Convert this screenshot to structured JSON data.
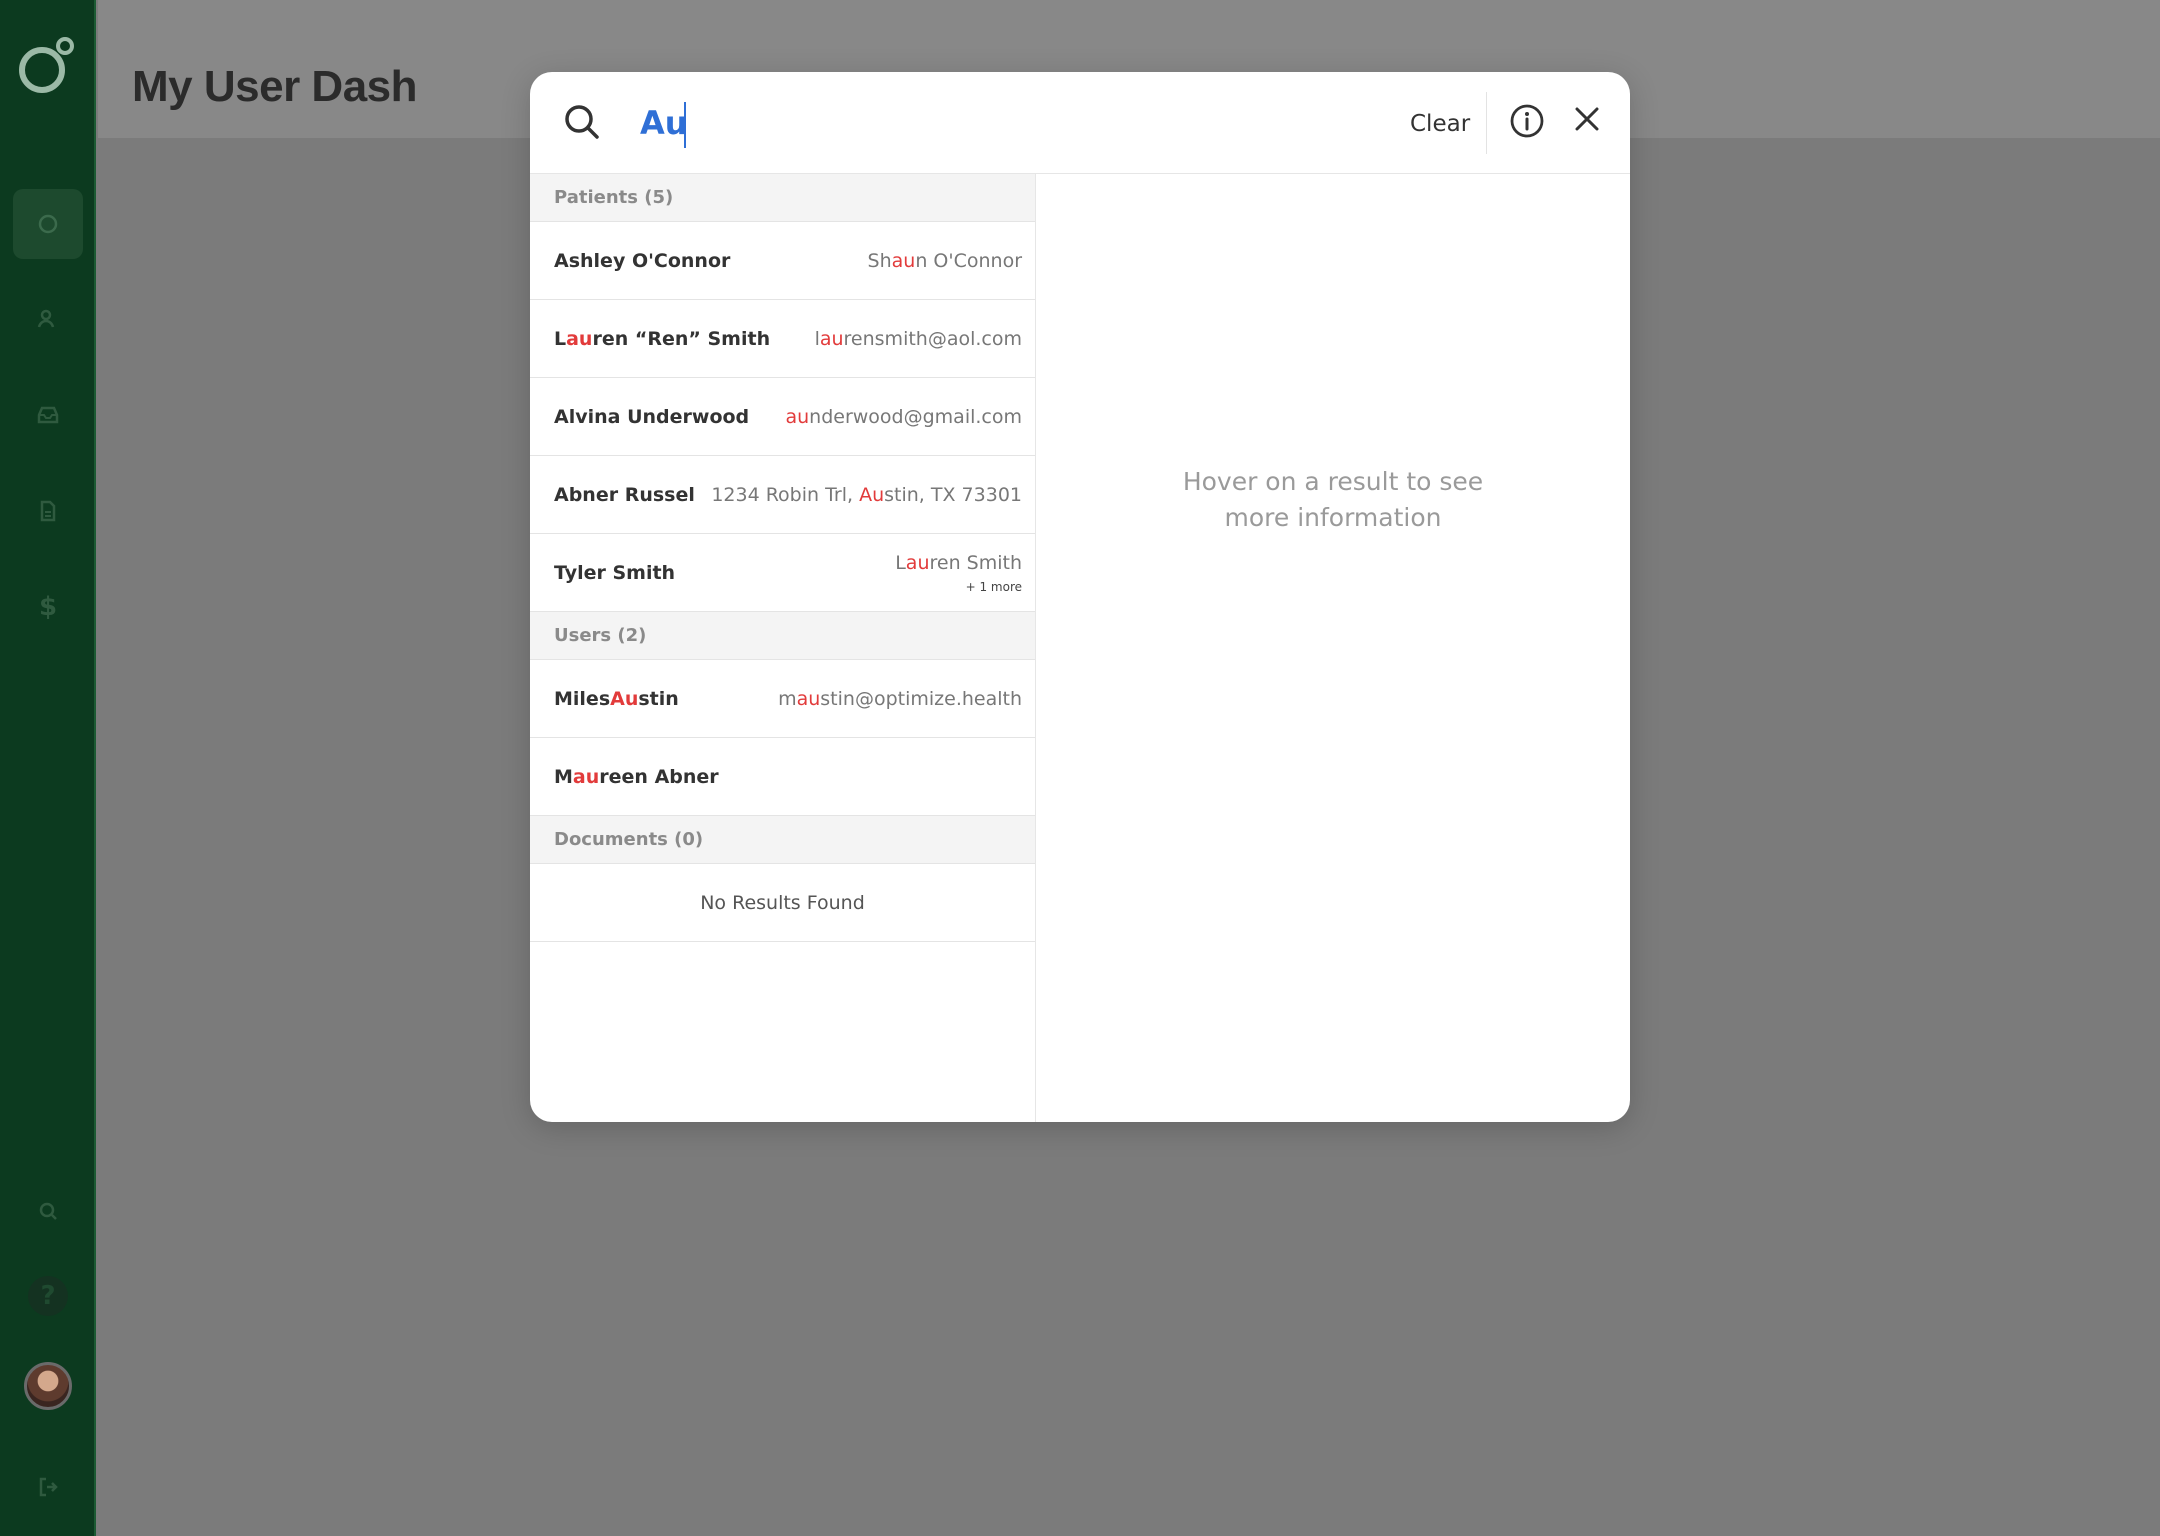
{
  "page": {
    "title": "My User Dash"
  },
  "colors": {
    "sidebar": "#0c3a1f",
    "highlight": "#e23b3b",
    "query": "#2f6fd6"
  },
  "nav": {
    "icons": [
      "home-icon",
      "users-icon",
      "inbox-icon",
      "documents-icon",
      "billing-icon",
      "search-icon",
      "help-icon",
      "logout-icon"
    ],
    "dollar": "$",
    "help": "?"
  },
  "search": {
    "query": "Au",
    "clear_label": "Clear"
  },
  "sections": {
    "patients": {
      "label": "Patients (5)",
      "rows": [
        {
          "name": [
            "Ashley O'Connor"
          ],
          "meta": [
            "Sh",
            "au",
            "n O'Connor"
          ]
        },
        {
          "name": [
            "L",
            "au",
            "ren “Ren” Smith"
          ],
          "meta": [
            "l",
            "au",
            "rensmith@aol.com"
          ]
        },
        {
          "name": [
            "Alvina Underwood"
          ],
          "meta": [
            "",
            "au",
            "nderwood@gmail.com"
          ]
        },
        {
          "name": [
            "Abner Russel"
          ],
          "meta": [
            "1234 Robin Trl, ",
            "Au",
            "stin, TX 73301"
          ]
        },
        {
          "name": [
            "Tyler Smith"
          ],
          "meta": [
            "L",
            "au",
            "ren Smith"
          ],
          "more": "+ 1 more"
        }
      ]
    },
    "users": {
      "label": "Users (2)",
      "rows": [
        {
          "name": [
            "Miles ",
            "Au",
            "stin"
          ],
          "meta": [
            "m",
            "au",
            "stin@optimize.health"
          ]
        },
        {
          "name": [
            "M",
            "au",
            "reen Abner"
          ],
          "meta": []
        }
      ]
    },
    "documents": {
      "label": "Documents (0)",
      "empty": "No Results Found"
    }
  },
  "detail": {
    "hint_line1": "Hover on a result to see",
    "hint_line2": "more information"
  }
}
